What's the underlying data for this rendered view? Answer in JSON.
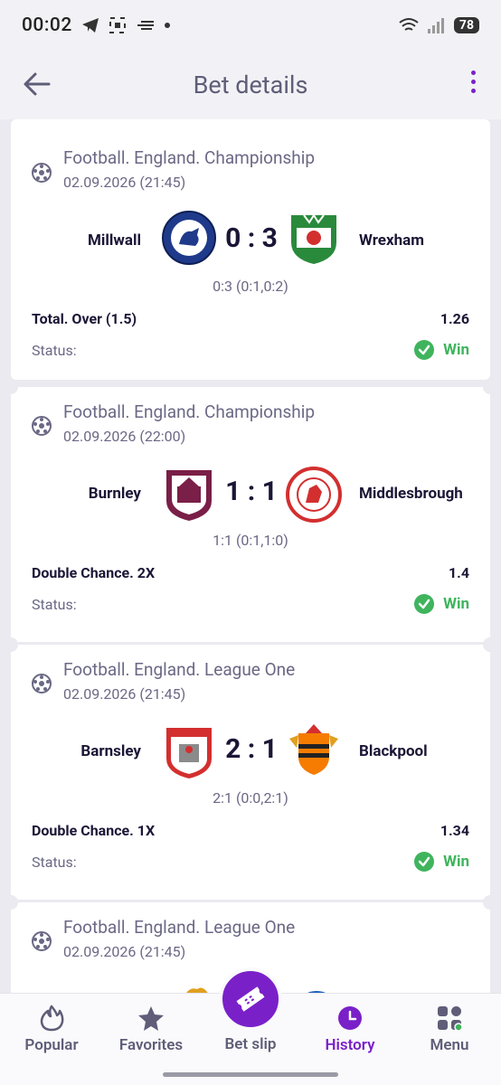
{
  "status_bar": {
    "time": "00:02",
    "battery": "78"
  },
  "header": {
    "title": "Bet details"
  },
  "bets": [
    {
      "league": "Football. England. Championship",
      "datetime": "02.09.2026 (21:45)",
      "home": "Millwall",
      "away": "Wrexham",
      "score": "0 : 3",
      "detail": "0:3 (0:1,0:2)",
      "market": "Total. Over (1.5)",
      "odds": "1.26",
      "status_label": "Status:",
      "status": "Win",
      "home_color": "#1f3a8a",
      "away_color": "#2a8a3c"
    },
    {
      "league": "Football. England. Championship",
      "datetime": "02.09.2026 (22:00)",
      "home": "Burnley",
      "away": "Middlesbrough",
      "score": "1 : 1",
      "detail": "1:1 (0:1,1:0)",
      "market": "Double Chance. 2X",
      "odds": "1.4",
      "status_label": "Status:",
      "status": "Win",
      "home_color": "#7a1f47",
      "away_color": "#d32f2f"
    },
    {
      "league": "Football. England. League One",
      "datetime": "02.09.2026 (21:45)",
      "home": "Barnsley",
      "away": "Blackpool",
      "score": "2 : 1",
      "detail": "2:1 (0:0,2:1)",
      "market": "Double Chance. 1X",
      "odds": "1.34",
      "status_label": "Status:",
      "status": "Win",
      "home_color": "#d32f2f",
      "away_color": "#f57c00"
    },
    {
      "league": "Football. England. League One",
      "datetime": "02.09.2026 (21:45)"
    }
  ],
  "nav": {
    "popular": "Popular",
    "favorites": "Favorites",
    "betslip": "Bet slip",
    "history": "History",
    "menu": "Menu"
  },
  "colors": {
    "accent": "#7a20c9",
    "win": "#3fb45d",
    "text": "#1b1636",
    "muted": "#6b6885"
  }
}
